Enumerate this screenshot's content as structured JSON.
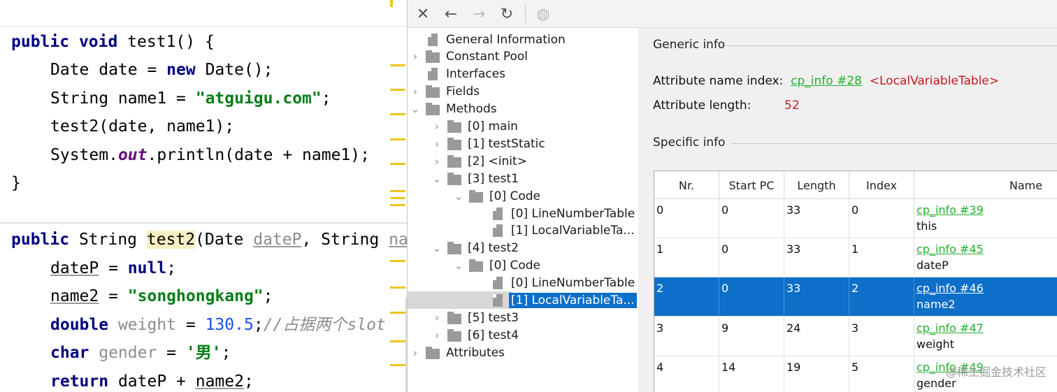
{
  "editor": {
    "method1": {
      "signature": {
        "kw1": "public",
        "kw2": "void",
        "rest": " test1() {"
      },
      "line2": {
        "pre": "Date date = ",
        "kw": "new",
        "post": " Date();"
      },
      "line3": {
        "pre": "String name1 = ",
        "str": "\"atguigu.com\"",
        "post": ";"
      },
      "line4": "test2(date, name1);",
      "line5": {
        "pre": "System.",
        "field": "out",
        "post": ".println(date + name1);"
      },
      "close": "}"
    },
    "method2": {
      "signature": {
        "kw1": "public",
        "type": " String ",
        "name": "test2",
        "open": "(Date ",
        "p1": "dateP",
        "mid": ", String ",
        "p2": "na"
      },
      "line2": {
        "var": "dateP",
        "op": " = ",
        "kw": "null",
        "post": ";"
      },
      "line3": {
        "var": "name2",
        "op": " = ",
        "str": "\"songhongkang\"",
        "post": ";"
      },
      "line4": {
        "kw": "double",
        "var": " weight",
        "op": " = ",
        "num": "130.5",
        "post": ";",
        "comment": "//占据两个slot"
      },
      "line5": {
        "kw": "char",
        "var": " gender",
        "op": " = ",
        "str": "'男'",
        "post": ";"
      },
      "line6": {
        "kw": "return",
        "pre": " dateP + ",
        "var": "name2",
        "post": ";"
      }
    }
  },
  "toolbar": {
    "close_icon": "close-icon",
    "back_icon": "arrow-left-icon",
    "forward_icon": "arrow-right-icon",
    "reload_icon": "reload-icon",
    "web_icon": "globe-icon"
  },
  "tree": {
    "items": [
      {
        "label": "General Information",
        "type": "doc"
      },
      {
        "label": "Constant Pool",
        "type": "folder",
        "state": "collapsed"
      },
      {
        "label": "Interfaces",
        "type": "doc"
      },
      {
        "label": "Fields",
        "type": "folder",
        "state": "collapsed"
      },
      {
        "label": "Methods",
        "type": "folder",
        "state": "expanded"
      },
      {
        "label": "[0] main",
        "type": "folder",
        "state": "collapsed"
      },
      {
        "label": "[1] testStatic",
        "type": "folder",
        "state": "collapsed"
      },
      {
        "label": "[2] <init>",
        "type": "folder",
        "state": "collapsed"
      },
      {
        "label": "[3] test1",
        "type": "folder",
        "state": "expanded"
      },
      {
        "label": "[0] Code",
        "type": "folder",
        "state": "expanded"
      },
      {
        "label": "[0] LineNumberTable",
        "type": "doc"
      },
      {
        "label": "[1] LocalVariableTa...",
        "type": "doc"
      },
      {
        "label": "[4] test2",
        "type": "folder",
        "state": "expanded"
      },
      {
        "label": "[0] Code",
        "type": "folder",
        "state": "expanded"
      },
      {
        "label": "[0] LineNumberTable",
        "type": "doc"
      },
      {
        "label": "[1] LocalVariableTa...",
        "type": "doc",
        "selected": true
      },
      {
        "label": "[5] test3",
        "type": "folder",
        "state": "collapsed"
      },
      {
        "label": "[6] test4",
        "type": "folder",
        "state": "collapsed"
      },
      {
        "label": "Attributes",
        "type": "folder",
        "state": "collapsed"
      }
    ]
  },
  "detail": {
    "generic_title": "Generic info",
    "name_index_label": "Attribute name index:",
    "name_index_link": "cp_info #28",
    "name_index_value": "<LocalVariableTable>",
    "length_label": "Attribute length:",
    "length_value": "52",
    "specific_title": "Specific info",
    "columns": [
      "Nr.",
      "Start PC",
      "Length",
      "Index",
      "Name"
    ],
    "rows": [
      {
        "nr": "0",
        "start_pc": "0",
        "length": "33",
        "index": "0",
        "name_link": "cp_info #39",
        "name": "this"
      },
      {
        "nr": "1",
        "start_pc": "0",
        "length": "33",
        "index": "1",
        "name_link": "cp_info #45",
        "name": "dateP"
      },
      {
        "nr": "2",
        "start_pc": "0",
        "length": "33",
        "index": "2",
        "name_link": "cp_info #46",
        "name": "name2",
        "selected": true
      },
      {
        "nr": "3",
        "start_pc": "9",
        "length": "24",
        "index": "3",
        "name_link": "cp_info #47",
        "name": "weight"
      },
      {
        "nr": "4",
        "start_pc": "14",
        "length": "19",
        "index": "5",
        "name_link": "cp_info #49",
        "name": "gender"
      }
    ]
  },
  "watermark": "@稀土掘金技术社区",
  "colors": {
    "selection": "#0d6fc9",
    "link": "#22b02b",
    "value_red": "#c8171f"
  }
}
